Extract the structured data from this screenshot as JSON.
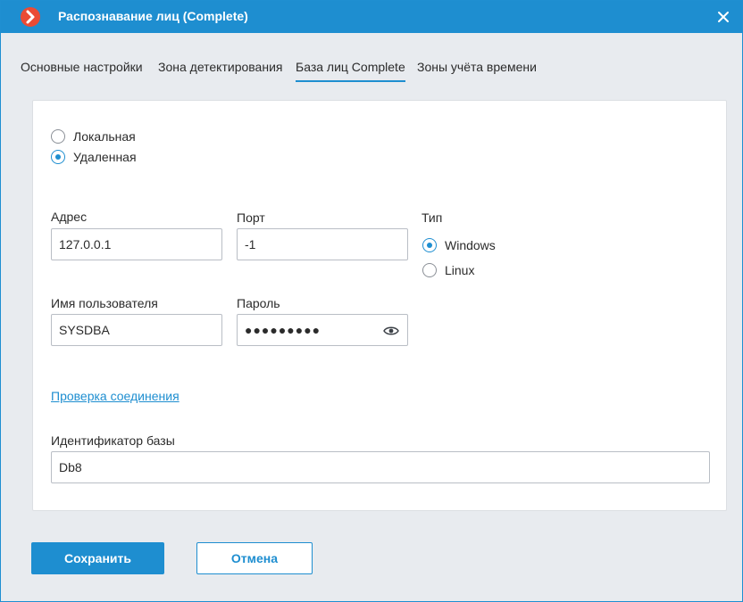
{
  "window": {
    "title": "Распознавание лиц (Complete)",
    "accent_color": "#1e8ed0",
    "logo_color": "#ea4b35",
    "icons": {
      "logo": "chevron-right-icon",
      "close": "close-icon"
    }
  },
  "tabs": [
    {
      "label": "Основные настройки",
      "active": false
    },
    {
      "label": "Зона детектирования",
      "active": false
    },
    {
      "label": "База лиц Complete",
      "active": true
    },
    {
      "label": "Зоны учёта времени",
      "active": false
    }
  ],
  "db_location": {
    "options": [
      {
        "label": "Локальная",
        "checked": false
      },
      {
        "label": "Удаленная",
        "checked": true
      }
    ]
  },
  "address": {
    "label": "Адрес",
    "value": "127.0.0.1"
  },
  "port": {
    "label": "Порт",
    "value": "-1"
  },
  "type": {
    "label": "Тип",
    "options": [
      {
        "label": "Windows",
        "checked": true
      },
      {
        "label": "Linux",
        "checked": false
      }
    ]
  },
  "username": {
    "label": "Имя пользователя",
    "value": "SYSDBA"
  },
  "password": {
    "label": "Пароль",
    "masked_value": "●●●●●●●●●",
    "icon": "eye-icon"
  },
  "check_connection": {
    "label": "Проверка соединения"
  },
  "db_id": {
    "label": "Идентификатор базы",
    "value": "Db8"
  },
  "buttons": {
    "save": "Сохранить",
    "cancel": "Отмена"
  }
}
